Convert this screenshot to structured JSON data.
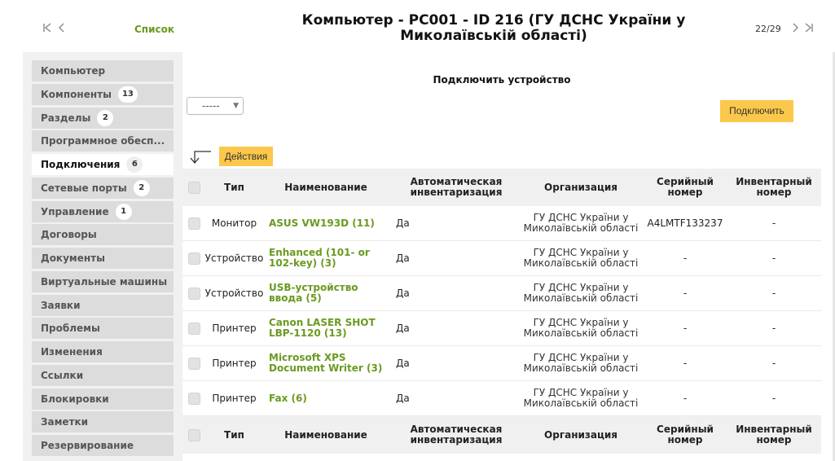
{
  "header": {
    "title": "Компьютер - PC001 - ID 216 (ГУ ДСНС України у Миколаївській області)",
    "list_link": "Список",
    "counter": "22/29",
    "icons": [
      "first-page-icon",
      "prev-page-icon",
      "next-page-icon",
      "last-page-icon"
    ]
  },
  "sidebar": {
    "items": [
      {
        "label": "Компьютер",
        "badge": ""
      },
      {
        "label": "Компоненты",
        "badge": "13"
      },
      {
        "label": "Разделы",
        "badge": "2"
      },
      {
        "label": "Программное обесп...",
        "badge": ""
      },
      {
        "label": "Подключения",
        "badge": "6",
        "active": true
      },
      {
        "label": "Сетевые порты",
        "badge": "2"
      },
      {
        "label": "Управление",
        "badge": "1"
      },
      {
        "label": "Договоры",
        "badge": ""
      },
      {
        "label": "Документы",
        "badge": ""
      },
      {
        "label": "Виртуальные машины",
        "badge": ""
      },
      {
        "label": "Заявки",
        "badge": ""
      },
      {
        "label": "Проблемы",
        "badge": ""
      },
      {
        "label": "Изменения",
        "badge": ""
      },
      {
        "label": "Ссылки",
        "badge": ""
      },
      {
        "label": "Блокировки",
        "badge": ""
      },
      {
        "label": "Заметки",
        "badge": ""
      },
      {
        "label": "Резервирование",
        "badge": ""
      }
    ]
  },
  "connect": {
    "title": "Подключить устройство",
    "select_value": "-----",
    "button": "Подключить"
  },
  "actions": {
    "button": "Действия"
  },
  "table": {
    "headers": {
      "type": "Тип",
      "name": "Наименование",
      "auto": "Автоматическая инвентаризация",
      "org": "Организация",
      "serial": "Серийный номер",
      "inv": "Инвентарный номер"
    },
    "rows": [
      {
        "type": "Монитор",
        "name": "ASUS VW193D (11)",
        "auto": "Да",
        "org": "ГУ ДСНС України у Миколаївській області",
        "serial": "A4LMTF133237",
        "inv": "-"
      },
      {
        "type": "Устройство",
        "name": "Enhanced (101- or 102-key) (3)",
        "auto": "Да",
        "org": "ГУ ДСНС України у Миколаївській області",
        "serial": "-",
        "inv": "-"
      },
      {
        "type": "Устройство",
        "name": "USB-устройство ввода (5)",
        "auto": "Да",
        "org": "ГУ ДСНС України у Миколаївській області",
        "serial": "-",
        "inv": "-"
      },
      {
        "type": "Принтер",
        "name": "Canon LASER SHOT LBP-1120 (13)",
        "auto": "Да",
        "org": "ГУ ДСНС України у Миколаївській області",
        "serial": "-",
        "inv": "-"
      },
      {
        "type": "Принтер",
        "name": "Microsoft XPS Document Writer (3)",
        "auto": "Да",
        "org": "ГУ ДСНС України у Миколаївській області",
        "serial": "-",
        "inv": "-"
      },
      {
        "type": "Принтер",
        "name": "Fax (6)",
        "auto": "Да",
        "org": "ГУ ДСНС України у Миколаївській області",
        "serial": "-",
        "inv": "-"
      }
    ]
  },
  "colors": {
    "accent_link": "#6a9a1f",
    "button_yellow": "#fcc84b",
    "tab_bg": "#dcdcdc"
  }
}
